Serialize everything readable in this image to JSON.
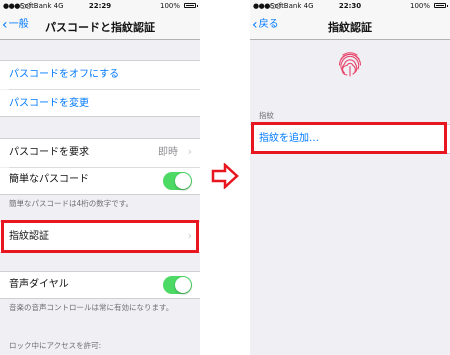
{
  "left": {
    "status": {
      "signal": "●●●○○",
      "carrier": "SoftBank  4G",
      "time": "22:29",
      "battery": "100%"
    },
    "nav": {
      "back_label": "一般",
      "title": "パスコードと指紋認証"
    },
    "rows": {
      "passcode_off": "パスコードをオフにする",
      "change_passcode": "パスコードを変更",
      "require_passcode": "パスコードを要求",
      "require_value": "即時",
      "simple_passcode": "簡単なパスコード",
      "simple_note": "簡単なパスコードは4桁の数字です。",
      "fingerprint": "指紋認証",
      "voice_dial": "音声ダイヤル",
      "voice_note": "音楽の音声コントロールは常に有効になります。",
      "lock_access": "ロック中にアクセスを許可:"
    },
    "toggles": {
      "simple_passcode": true,
      "voice_dial": true
    }
  },
  "right": {
    "status": {
      "signal": "●●●○○",
      "carrier": "SoftBank  4G",
      "time": "22:30",
      "battery": "100%"
    },
    "nav": {
      "back_label": "戻る",
      "title": "指紋認証"
    },
    "section_header": "指紋",
    "add_fingerprint": "指紋を追加…"
  },
  "colors": {
    "accent": "#007aff",
    "highlight": "#e8161f",
    "toggle_on": "#4cd964",
    "fingerprint": "#e8456b"
  },
  "icons": {
    "back": "chevron-left-icon",
    "disclosure": "chevron-right-icon",
    "transition": "arrow-right-icon",
    "fingerprint": "fingerprint-icon"
  }
}
